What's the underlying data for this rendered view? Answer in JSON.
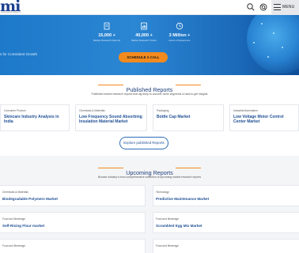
{
  "header": {
    "logo_text": "mi",
    "logo_subtext": "marketsandintelligence",
    "menu_label": "MENU"
  },
  "hero": {
    "tagline": "s for Consistent Growth",
    "stats": [
      {
        "number": "15,000 +",
        "label": "Market Research Reports",
        "icon": "document-icon"
      },
      {
        "number": "40,000 +",
        "label": "Market Research Topics",
        "icon": "chart-icon"
      },
      {
        "number": "3 Million +",
        "label": "Hours of Experience",
        "icon": "clock-icon"
      }
    ],
    "cta_label": "SCHEDULE A CALL"
  },
  "published": {
    "title": "Published Reports",
    "subtitle": "Published market research reports that dig deep to uncover niche segments & hard-to-get insights",
    "cards": [
      {
        "category": "Consumer Product",
        "title": "Skincare Industry Analysis in India"
      },
      {
        "category": "Chemicals & Materials",
        "title": "Low Frequency Sound Absorbing Insulation Material Market"
      },
      {
        "category": "Packaging",
        "title": "Bottle Cap Market"
      },
      {
        "category": "Industrial Automation",
        "title": "Low Voltage Motor Control Center Market"
      }
    ],
    "explore_label": "Explore published Reports"
  },
  "upcoming": {
    "title": "Upcoming Reports",
    "subtitle": "Browse industry's most comprehensive collection of upcoming market research reports",
    "cards": [
      {
        "category": "Chemicals & Materials",
        "title": "Biodegradable Polymers Market"
      },
      {
        "category": "Technology",
        "title": "Predictive Maintenance Market"
      },
      {
        "category": "Food and Beverage",
        "title": "Self-Rising Flour market"
      },
      {
        "category": "Food and Beverage",
        "title": "Scrambled Egg Mix Market"
      },
      {
        "category": "Food and Beverage",
        "title": ""
      },
      {
        "category": "Food and Beverage",
        "title": ""
      }
    ]
  }
}
